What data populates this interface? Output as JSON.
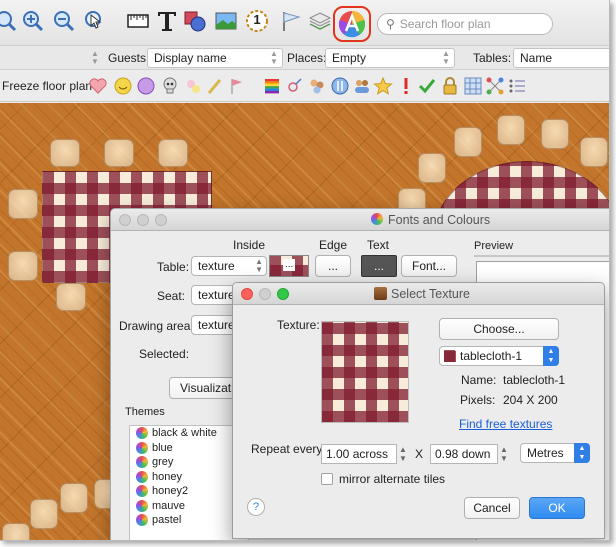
{
  "toolbar": {
    "search_placeholder": "Search floor plan",
    "seat_number": "1",
    "icons": [
      "zoom-out-icon",
      "zoom-in-icon",
      "zoom-minus-icon",
      "pointer-icon",
      "ruler-icon",
      "text-tool-icon",
      "shapes-icon",
      "image-icon",
      "seat-number-icon",
      "flag-icon",
      "layers-icon",
      "fonts-colours-icon"
    ]
  },
  "filterbar": {
    "guests_label": "Guests:",
    "guests_value": "Display name",
    "places_label": "Places:",
    "places_value": "Empty",
    "tables_label": "Tables:",
    "tables_value": "Name"
  },
  "freezebar": {
    "label": "Freeze floor plan"
  },
  "fonts_window": {
    "title": "Fonts and Colours",
    "col_inside": "Inside",
    "col_edge": "Edge",
    "col_text": "Text",
    "table_label": "Table:",
    "table_inside": "texture",
    "dots": "...",
    "font_button": "Font...",
    "seat_label": "Seat:",
    "seat_inside": "texture",
    "drawing_label": "Drawing area:",
    "drawing_inside": "texture",
    "selected_label": "Selected:",
    "visualization_button": "Visualizati",
    "preview_label": "Preview",
    "themes_label": "Themes",
    "themes": [
      "black & white",
      "blue",
      "grey",
      "honey",
      "honey2",
      "mauve",
      "pastel"
    ]
  },
  "texture_window": {
    "title": "Select Texture",
    "texture_label": "Texture:",
    "choose_button": "Choose...",
    "texture_name_select": "tablecloth-1",
    "name_label": "Name:",
    "name_value": "tablecloth-1",
    "pixels_label": "Pixels:",
    "pixels_value": "204 X 200",
    "find_link": "Find free textures",
    "repeat_label": "Repeat every:",
    "across_value": "1.00 across",
    "x_label": "X",
    "down_value": "0.98 down",
    "unit_value": "Metres",
    "mirror_label": "mirror alternate tiles",
    "help": "?",
    "cancel_button": "Cancel",
    "ok_button": "OK"
  },
  "colors": {
    "accent": "#e0341c",
    "ok_blue": "#2f8cf0",
    "tablecloth_red": "#801c30",
    "floor_wood": "#c2752b"
  }
}
